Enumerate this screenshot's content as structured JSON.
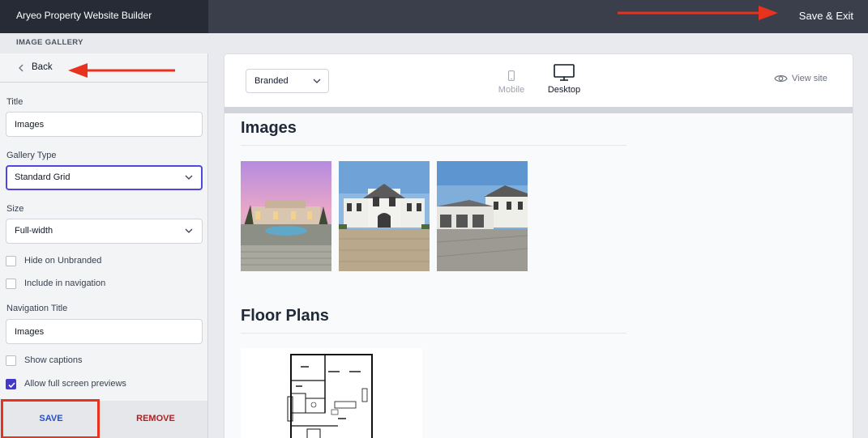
{
  "app": {
    "title": "Aryeo Property Website Builder",
    "save_exit_label": "Save & Exit"
  },
  "section_label": "IMAGE GALLERY",
  "sidebar": {
    "back_label": "Back",
    "title_label": "Title",
    "title_value": "Images",
    "gallery_type_label": "Gallery Type",
    "gallery_type_value": "Standard Grid",
    "size_label": "Size",
    "size_value": "Full-width",
    "hide_unbranded_label": "Hide on Unbranded",
    "hide_unbranded_checked": false,
    "include_nav_label": "Include in navigation",
    "include_nav_checked": false,
    "nav_title_label": "Navigation Title",
    "nav_title_value": "Images",
    "show_captions_label": "Show captions",
    "show_captions_checked": false,
    "full_screen_label": "Allow full screen previews",
    "full_screen_checked": true,
    "save_label": "SAVE",
    "remove_label": "REMOVE"
  },
  "preview": {
    "variant_value": "Branded",
    "device_mobile_label": "Mobile",
    "device_desktop_label": "Desktop",
    "active_device": "Desktop",
    "view_site_label": "View site",
    "images_heading": "Images",
    "floor_plans_heading": "Floor Plans",
    "thumbnails": [
      "pool-terrace-dusk-photo",
      "front-facade-photo",
      "garage-driveway-photo"
    ]
  },
  "colors": {
    "accent": "#4338ca",
    "save_text": "#1d4ed8",
    "remove_text": "#b91c1c",
    "annotation_red": "#e8321e",
    "topbar": "#3a3f4b"
  }
}
